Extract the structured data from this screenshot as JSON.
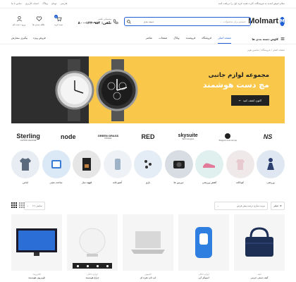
{
  "topbar": {
    "message": "سلام خوش آمدید به فروشگاه، کارت هدیه خرید اول را دریافت کنید",
    "links": [
      "تماس با ما",
      "حساب کاربری",
      "وبلاگ",
      "تومان",
      "فارسی"
    ]
  },
  "header": {
    "logo_text": "Molmart",
    "search_placeholder": "جستجو برای محصولات ...",
    "search_category": "دسته بندی",
    "phone_label": "پشتیبانی تلفنی",
    "phone_number": "تلفن: ۹۵۴-۱۲۳-۸۰۰",
    "icons": [
      {
        "name": "account",
        "label": "ورود / ثبت نام"
      },
      {
        "name": "wishlist",
        "label": "علاقه مندی ها"
      },
      {
        "name": "cart",
        "label": "سبد خرید",
        "badge": "0"
      }
    ]
  },
  "nav": {
    "all_categories": "کاوش دسته بندی ها",
    "items": [
      "صفحه اصلی",
      "فروشگاه",
      "فروشنده",
      "وبلاگ",
      "صفحات",
      "عناصر"
    ],
    "active_index": 0,
    "right_links": [
      "پیگیری سفارش",
      "فروش ویژه"
    ]
  },
  "breadcrumb": "صفحه اصلی  /  فروشگاه  /  ماشین هوم",
  "hero": {
    "title": "مجموعه لوازم جانبی",
    "subtitle": "مچ دست هوشمند",
    "cta": "اکنون کشف کنید"
  },
  "brands": [
    {
      "name": "Sterling",
      "sub": "COFFEE MACHINE"
    },
    {
      "name": "node",
      "sub": ""
    },
    {
      "name": "GREEN GRASS",
      "sub": "DESIGN"
    },
    {
      "name": "RED",
      "sub": ""
    },
    {
      "name": "skysuite",
      "sub": "Technologies"
    },
    {
      "name": "",
      "sub": "Elegant Auto Group"
    },
    {
      "name": "NS",
      "sub": ""
    }
  ],
  "categories": [
    {
      "label": "لباس",
      "icon": "shirt-icon"
    },
    {
      "label": "ساعت مچی",
      "icon": "watch-icon"
    },
    {
      "label": "قهوه ساز",
      "icon": "coffee-machine-icon"
    },
    {
      "label": "آشپزخانه",
      "icon": "kitchen-icon"
    },
    {
      "label": "بازی",
      "icon": "game-icon"
    },
    {
      "label": "دوربین ها",
      "icon": "camera-icon"
    },
    {
      "label": "کفش ورزشی",
      "icon": "sneakers-icon"
    },
    {
      "label": "کودکانه",
      "icon": "kids-icon"
    },
    {
      "label": "ورزشی",
      "icon": "sports-icon"
    }
  ],
  "toolbar": {
    "filter": "فیلتر",
    "sort": "ترتیب: پیش فرض",
    "sort_selected": "مرتب سازی ترتیب پیش فرض",
    "show": "نمایش: ۱۲"
  },
  "products": [
    {
      "category": "الکترونیک",
      "name": "تلویزیون هوشمند"
    },
    {
      "category": "لوازم خانگی",
      "name": "چراغ هوشمند"
    },
    {
      "category": "کامپیوتر",
      "name": "لپ تاپ نقره ای"
    },
    {
      "category": "لوازم خانگی",
      "name": "اسپیکر آبی"
    },
    {
      "category": "کیف",
      "name": "کیف دستی چرمی"
    }
  ]
}
